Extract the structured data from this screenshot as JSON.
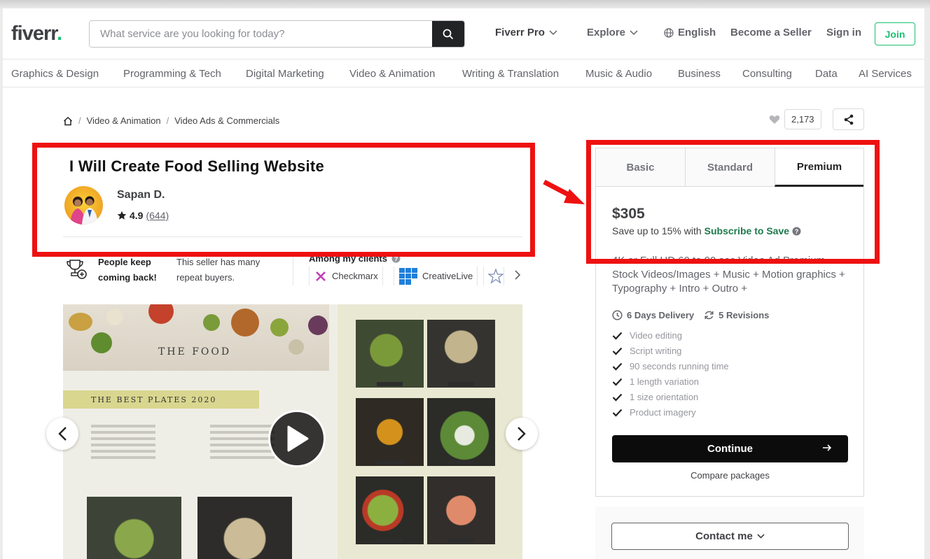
{
  "header": {
    "logo_text": "fiverr",
    "logo_dot": ".",
    "search_placeholder": "What service are you looking for today?",
    "search_icon": "search-icon",
    "fiverr_pro": "Fiverr Pro",
    "explore": "Explore",
    "language": "English",
    "become_seller": "Become a Seller",
    "sign_in": "Sign in",
    "join": "Join"
  },
  "categories": [
    "Graphics & Design",
    "Programming & Tech",
    "Digital Marketing",
    "Video & Animation",
    "Writing & Translation",
    "Music & Audio",
    "Business",
    "Consulting",
    "Data",
    "AI Services"
  ],
  "breadcrumb": {
    "home_icon": "home-icon",
    "items": [
      "Video & Animation",
      "Video Ads & Commercials"
    ],
    "separator": "/"
  },
  "actions": {
    "like_count": "2,173",
    "like_icon": "heart-icon",
    "share_icon": "share-icon"
  },
  "gig": {
    "title": "I Will Create Food Selling Website",
    "seller_name": "Sapan D.",
    "rating": "4.9",
    "reviews": "(644)"
  },
  "highlights": {
    "repeat_bold_1": "People keep",
    "repeat_bold_2": "coming back!",
    "repeat_text_1": "This seller has many",
    "repeat_text_2": "repeat buyers.",
    "clients_title": "Among my clients",
    "clients": [
      "Checkmarx",
      "CreativeLive"
    ]
  },
  "gallery": {
    "heading": "THE FOOD",
    "band": "THE BEST PLATES 2020",
    "play_icon": "play-icon"
  },
  "package": {
    "tabs": [
      "Basic",
      "Standard",
      "Premium"
    ],
    "active_tab": "Premium",
    "price": "$305",
    "save_prefix": "Save up to 15% with",
    "save_link": "Subscribe to Save",
    "description": "4K or Full HD 60 to 90 sec Video Ad Premium Stock Videos/Images + Music + Motion graphics + Typography + Intro + Outro +",
    "delivery": "6 Days Delivery",
    "revisions": "5 Revisions",
    "features": [
      "Video editing",
      "Script writing",
      "90 seconds running time",
      "1 length variation",
      "1 size orientation",
      "Product imagery"
    ],
    "continue": "Continue",
    "compare": "Compare packages",
    "contact": "Contact me"
  },
  "colors": {
    "brand_green": "#1dbf73",
    "highlight_red": "#ee1111",
    "dark": "#222325"
  }
}
